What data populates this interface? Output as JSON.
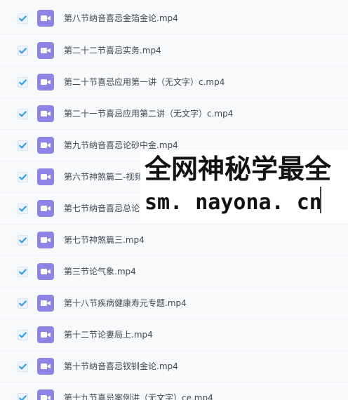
{
  "files": [
    {
      "name": "第八节纳音喜忌金箔金论.mp4",
      "checked": true
    },
    {
      "name": "第二十二节喜忌实务.mp4",
      "checked": true
    },
    {
      "name": "第二十节喜忌应用第一讲（无文字）c.mp4",
      "checked": true
    },
    {
      "name": "第二十一节喜忌应用第二讲（无文字）c.mp4",
      "checked": true
    },
    {
      "name": "第九节纳音喜忌论砂中金.mp4",
      "checked": true
    },
    {
      "name": "第六节神煞篇二-视频",
      "checked": true
    },
    {
      "name": "第七节纳音喜忌总论",
      "checked": true
    },
    {
      "name": "第七节神煞篇三.mp4",
      "checked": true
    },
    {
      "name": "第三节论气象.mp4",
      "checked": true
    },
    {
      "name": "第十八节疾病健康寿元专题.mp4",
      "checked": true
    },
    {
      "name": "第十二节论妻局上.mp4",
      "checked": true
    },
    {
      "name": "第十节纳音喜忌钗钏金论.mp4",
      "checked": true
    },
    {
      "name": "第十九节喜忌案例讲（无文字）ce.mp4",
      "checked": true
    }
  ],
  "icons": {
    "checkbox": "checkmark-icon",
    "file": "video-file-icon"
  },
  "colors": {
    "check": "#2f9fe8",
    "video_icon": "#8f84e6",
    "text": "#3f4753"
  },
  "watermark": {
    "line1": "全网神秘学最全",
    "line2": "sm. nayona. cn"
  }
}
